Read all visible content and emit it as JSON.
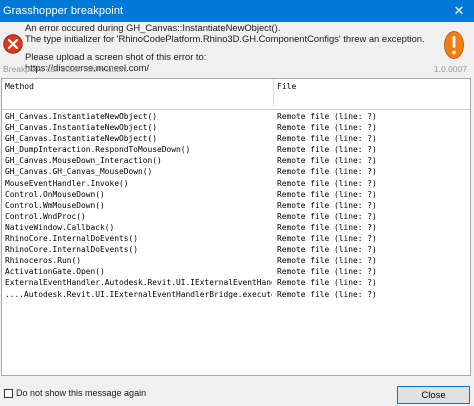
{
  "window": {
    "title": "Grasshopper breakpoint",
    "close_glyph": "✕"
  },
  "message": {
    "line1": "An error occured during GH_Canvas::InstantiateNewObject().",
    "line2": "The type initializer for 'RhinoCodePlatform.Rhino3D.GH.ComponentConfigs' threw an exception.",
    "line3": "Please upload a screen shot of this error to:",
    "line4": "https://discourse.mcneel.com/",
    "error_icon": "error-icon",
    "warning_icon": "warning-icon"
  },
  "stack": {
    "label": "Breakpoint call stack information:",
    "version": "1.0.0007",
    "columns": [
      "Method",
      "File"
    ],
    "rows": [
      {
        "method": "GH_Canvas.InstantiateNewObject()",
        "file": "Remote file (line: ?)"
      },
      {
        "method": "GH_Canvas.InstantiateNewObject()",
        "file": "Remote file (line: ?)"
      },
      {
        "method": "GH_Canvas.InstantiateNewObject()",
        "file": "Remote file (line: ?)"
      },
      {
        "method": "GH_DumpInteraction.RespondToMouseDown()",
        "file": "Remote file (line: ?)"
      },
      {
        "method": "GH_Canvas.MouseDown_Interaction()",
        "file": "Remote file (line: ?)"
      },
      {
        "method": "GH_Canvas.GH_Canvas_MouseDown()",
        "file": "Remote file (line: ?)"
      },
      {
        "method": "MouseEventHandler.Invoke()",
        "file": "Remote file (line: ?)"
      },
      {
        "method": "Control.OnMouseDown()",
        "file": "Remote file (line: ?)"
      },
      {
        "method": "Control.WmMouseDown()",
        "file": "Remote file (line: ?)"
      },
      {
        "method": "Control.WndProc()",
        "file": "Remote file (line: ?)"
      },
      {
        "method": "NativeWindow.Callback()",
        "file": "Remote file (line: ?)"
      },
      {
        "method": "RhinoCore.InternalDoEvents()",
        "file": "Remote file (line: ?)"
      },
      {
        "method": "RhinoCore.InternalDoEvents()",
        "file": "Remote file (line: ?)"
      },
      {
        "method": "Rhinoceros.Run()",
        "file": "Remote file (line: ?)"
      },
      {
        "method": "ActivationGate.Open()",
        "file": "Remote file (line: ?)"
      },
      {
        "method": "ExternalEventHandler.Autodesk.Revit.UI.IExternalEventHand...",
        "file": "Remote file (line: ?)"
      },
      {
        "method": "....Autodesk.Revit.UI.IExternalEventHandlerBridge.execute_()",
        "file": "Remote file (line: ?)"
      }
    ]
  },
  "footer": {
    "checkbox_label": "Do not show this message again",
    "checkbox_checked": false,
    "close_label": "Close"
  },
  "colors": {
    "titlebar": "#0078d7",
    "error_red": "#d9391b",
    "warning_orange": "#f07e12",
    "button_border": "#0078d7"
  }
}
